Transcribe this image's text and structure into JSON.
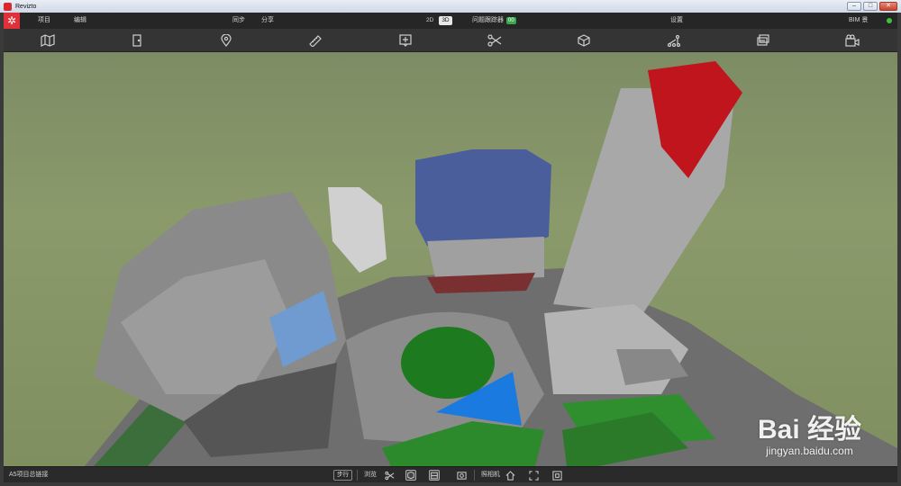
{
  "window": {
    "title": "Revizto"
  },
  "menu": {
    "project": "项目",
    "edit": "编辑",
    "sync": "同步",
    "share": "分享",
    "view_2d": "2D",
    "view_3d": "3D",
    "issue_tracker": "问题跟踪器",
    "issue_count": "00",
    "settings": "设置",
    "bim": "BIM 景"
  },
  "toolbar": {
    "icons": [
      "map-marker-icon",
      "door-icon",
      "location-pin-icon",
      "ruler-icon",
      "add-issue-icon",
      "scissors-icon",
      "cube-icon",
      "section-tree-icon",
      "layers-icon",
      "camera-icon"
    ]
  },
  "statusbar": {
    "project_name": "A5项目总链接",
    "walk_button": "步行",
    "browse": "浏览",
    "camera_label": "照相机"
  },
  "watermark": {
    "main": "Bai 经验",
    "sub": "jingyan.baidu.com"
  }
}
